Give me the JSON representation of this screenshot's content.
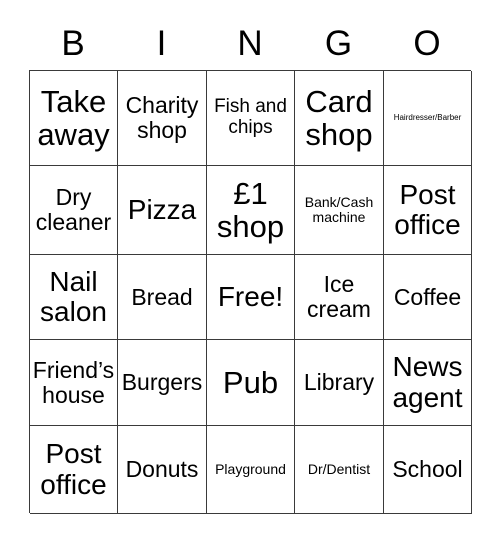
{
  "card": {
    "title": "BINGO",
    "header_letters": [
      "B",
      "I",
      "N",
      "G",
      "O"
    ],
    "grid_size": "5x5",
    "border_color": "#3a3a3a",
    "background_color": "#ffffff",
    "text_color": "#000000",
    "free_space_label": "Free!",
    "free_space_position": "row3-col3"
  },
  "rows": [
    {
      "cells": [
        {
          "label": "Take away",
          "size": "fs-xl"
        },
        {
          "label": "Charity shop",
          "size": "fs-md"
        },
        {
          "label": "Fish and chips",
          "size": "fs-sm"
        },
        {
          "label": "Card shop",
          "size": "fs-xl"
        },
        {
          "label": "Hairdresser/Barber",
          "size": "fs-xxs"
        }
      ]
    },
    {
      "cells": [
        {
          "label": "Dry cleaner",
          "size": "fs-md"
        },
        {
          "label": "Pizza",
          "size": "fs-lg"
        },
        {
          "label": "£1 shop",
          "size": "fs-xl"
        },
        {
          "label": "Bank/Cash machine",
          "size": "fs-xs"
        },
        {
          "label": "Post office",
          "size": "fs-lg"
        }
      ]
    },
    {
      "cells": [
        {
          "label": "Nail salon",
          "size": "fs-lg"
        },
        {
          "label": "Bread",
          "size": "fs-md"
        },
        {
          "label": "Free!",
          "size": "fs-lg"
        },
        {
          "label": "Ice cream",
          "size": "fs-md"
        },
        {
          "label": "Coffee",
          "size": "fs-md"
        }
      ]
    },
    {
      "cells": [
        {
          "label": "Friend’s house",
          "size": "fs-md"
        },
        {
          "label": "Burgers",
          "size": "fs-md"
        },
        {
          "label": "Pub",
          "size": "fs-xl"
        },
        {
          "label": "Library",
          "size": "fs-md"
        },
        {
          "label": "News agent",
          "size": "fs-lg"
        }
      ]
    },
    {
      "cells": [
        {
          "label": "Post office",
          "size": "fs-lg"
        },
        {
          "label": "Donuts",
          "size": "fs-md"
        },
        {
          "label": "Playground",
          "size": "fs-xs"
        },
        {
          "label": "Dr/Dentist",
          "size": "fs-xs"
        },
        {
          "label": "School",
          "size": "fs-md"
        }
      ]
    }
  ]
}
